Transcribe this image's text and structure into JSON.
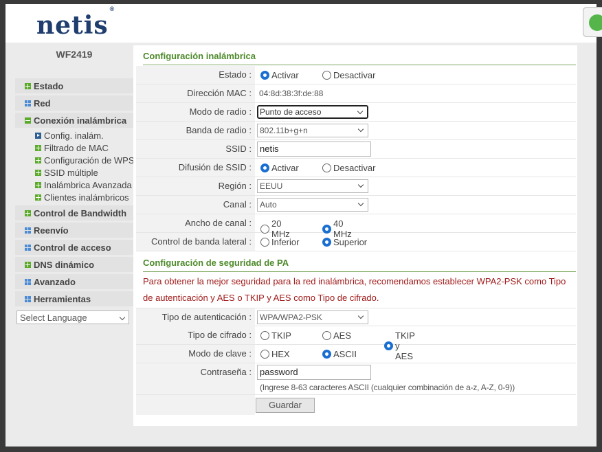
{
  "header": {
    "logo": "netis",
    "logo_mark": "®"
  },
  "sidebar": {
    "model": "WF2419",
    "items": [
      {
        "label": "Estado",
        "icon": "plus-icon"
      },
      {
        "label": "Red",
        "icon": "grid-icon"
      },
      {
        "label": "Conexión inalámbrica",
        "icon": "minus-icon"
      },
      {
        "label": "Control de Bandwidth",
        "icon": "plus-icon"
      },
      {
        "label": "Reenvío",
        "icon": "grid-icon"
      },
      {
        "label": "Control de acceso",
        "icon": "grid-icon"
      },
      {
        "label": "DNS dinámico",
        "icon": "plus-icon"
      },
      {
        "label": "Avanzado",
        "icon": "grid-icon"
      },
      {
        "label": "Herramientas",
        "icon": "grid-icon"
      }
    ],
    "subitems": [
      {
        "label": "Config. inalám.",
        "icon": "arrow-icon"
      },
      {
        "label": "Filtrado de MAC",
        "icon": "plus-icon"
      },
      {
        "label": "Configuración de WPS",
        "icon": "plus-icon"
      },
      {
        "label": "SSID múltiple",
        "icon": "plus-icon"
      },
      {
        "label": "Inalámbrica Avanzada",
        "icon": "plus-icon"
      },
      {
        "label": "Clientes inalámbricos",
        "icon": "plus-icon"
      }
    ],
    "language": "Select Language"
  },
  "wireless": {
    "title": "Configuración inalámbrica",
    "status": {
      "label": "Estado :",
      "on": "Activar",
      "off": "Desactivar",
      "selected": "Activar"
    },
    "mac": {
      "label": "Dirección MAC :",
      "value": "04:8d:38:3f:de:88"
    },
    "radio_mode": {
      "label": "Modo de radio :",
      "value": "Punto de acceso"
    },
    "band": {
      "label": "Banda de radio :",
      "value": "802.11b+g+n"
    },
    "ssid": {
      "label": "SSID :",
      "value": "netis"
    },
    "broadcast": {
      "label": "Difusión de SSID :",
      "on": "Activar",
      "off": "Desactivar",
      "selected": "Activar"
    },
    "region": {
      "label": "Región :",
      "value": "EEUU"
    },
    "channel": {
      "label": "Canal :",
      "value": "Auto"
    },
    "width": {
      "label": "Ancho de canal :",
      "opt1": "20 MHz",
      "opt2": "40 MHz",
      "selected": "40 MHz"
    },
    "sideband": {
      "label": "Control de banda lateral :",
      "opt1": "Inferior",
      "opt2": "Superior",
      "selected": "Superior"
    }
  },
  "security": {
    "title": "Configuración de seguridad de PA",
    "warning1": "Para obtener la mejor seguridad para la red inalámbrica, recomendamos establecer WPA2-PSK como Tipo",
    "warning2": "de autenticación y AES o TKIP y AES como Tipo de cifrado.",
    "auth": {
      "label": "Tipo de autenticación :",
      "value": "WPA/WPA2-PSK"
    },
    "cipher": {
      "label": "Tipo de cifrado :",
      "opt1": "TKIP",
      "opt2": "AES",
      "opt3": "TKIP y AES",
      "selected": "TKIP y AES"
    },
    "keymode": {
      "label": "Modo de clave :",
      "opt1": "HEX",
      "opt2": "ASCII",
      "selected": "ASCII"
    },
    "password": {
      "label": "Contraseña :",
      "value": "password"
    },
    "hint": "(Ingrese 8-63 caracteres ASCII (cualquier combinación de a-z, A-Z, 0-9))",
    "save": "Guardar"
  },
  "colors": {
    "accent_green": "#4d8a2a",
    "warning_red": "#a01a1a",
    "logo_blue": "#1f3e6e",
    "radio_blue": "#1a6fd1"
  }
}
